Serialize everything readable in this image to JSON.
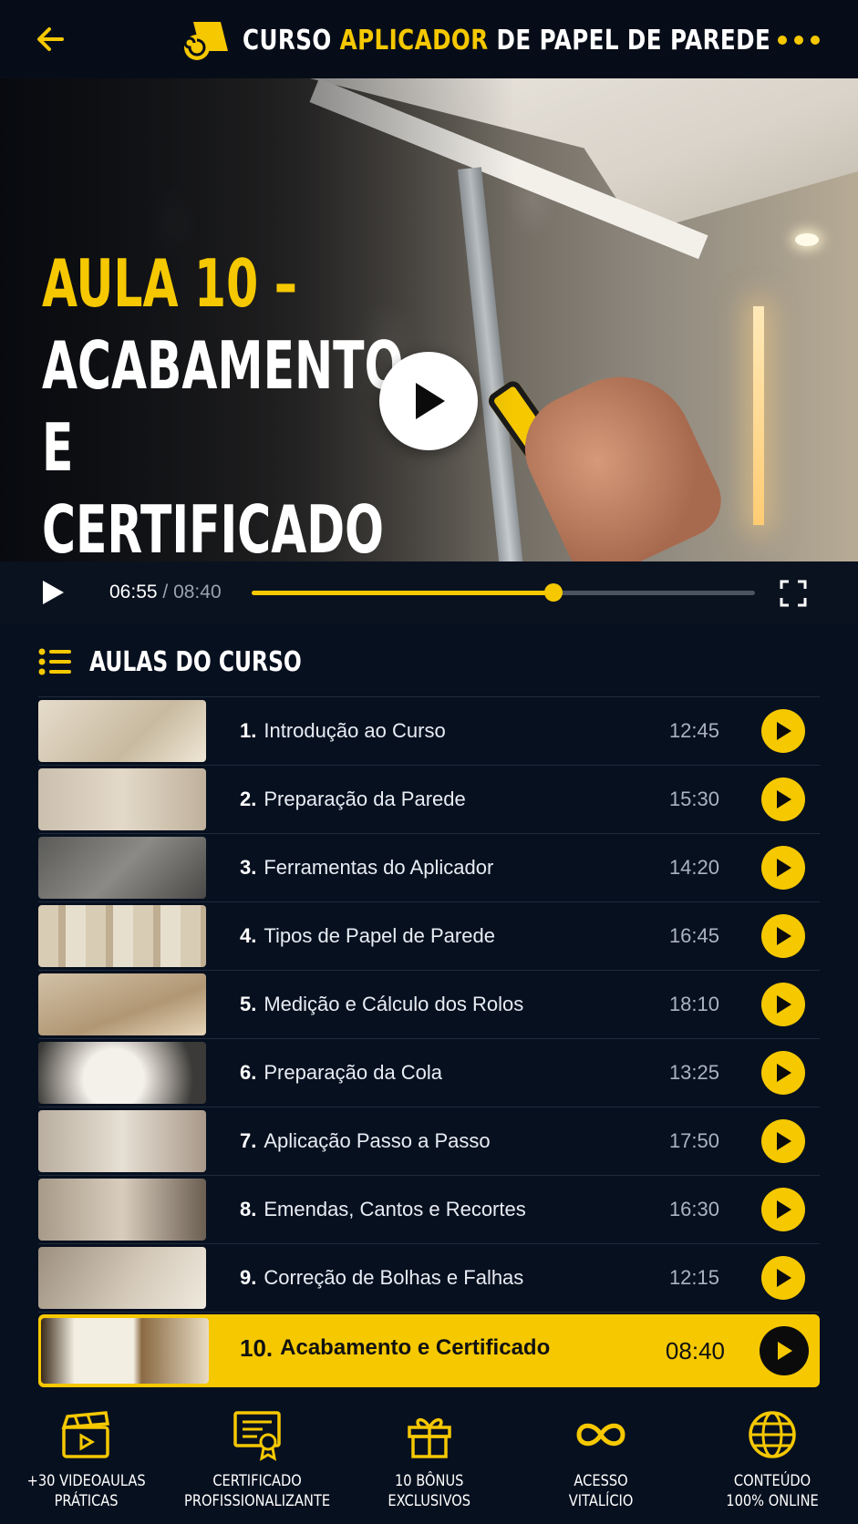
{
  "header": {
    "title_part1": "CURSO ",
    "title_highlight": "APLICADOR",
    "title_part2": " DE PAPEL DE PAREDE",
    "back_icon": "arrow-left-icon",
    "more_icon": "more-dots-icon"
  },
  "video": {
    "lesson_number": "AULA 10 –",
    "lesson_title": "ACABAMENTO E\nCERTIFICADO",
    "current_time": "06:55",
    "separator": " / ",
    "total_time": "08:40",
    "progress_fraction": 0.6
  },
  "lessons_section": {
    "title": "AULAS DO CURSO",
    "items": [
      {
        "num": "1.",
        "title": "Introdução ao Curso",
        "duration": "12:45",
        "thumb": "wallpaper-rolls"
      },
      {
        "num": "2.",
        "title": "Preparação da Parede",
        "duration": "15:30",
        "thumb": "brush-wall"
      },
      {
        "num": "3.",
        "title": "Ferramentas do Aplicador",
        "duration": "14:20",
        "thumb": "tools"
      },
      {
        "num": "4.",
        "title": "Tipos de Papel de Parede",
        "duration": "16:45",
        "thumb": "rolls-row"
      },
      {
        "num": "5.",
        "title": "Medição e Cálculo dos Rolos",
        "duration": "18:10",
        "thumb": "measuring-tape"
      },
      {
        "num": "6.",
        "title": "Preparação da Cola",
        "duration": "13:25",
        "thumb": "glue-bucket"
      },
      {
        "num": "7.",
        "title": "Aplicação Passo a Passo",
        "duration": "17:50",
        "thumb": "applying"
      },
      {
        "num": "8.",
        "title": "Emendas, Cantos e Recortes",
        "duration": "16:30",
        "thumb": "trimming"
      },
      {
        "num": "9.",
        "title": "Correção de Bolhas e Falhas",
        "duration": "12:15",
        "thumb": "smoothing"
      },
      {
        "num": "10.",
        "title": "Acabamento e Certificado",
        "duration": "08:40",
        "thumb": "certificate",
        "active": true
      }
    ]
  },
  "features": [
    {
      "icon": "clapperboard-icon",
      "text": "+30 VIDEOAULAS\nPRÁTICAS"
    },
    {
      "icon": "certificate-icon",
      "text": "CERTIFICADO\nPROFISSIONALIZANTE"
    },
    {
      "icon": "gift-icon",
      "text": "10 BÔNUS\nEXCLUSIVOS"
    },
    {
      "icon": "infinity-icon",
      "text": "ACESSO\nVITALÍCIO"
    },
    {
      "icon": "globe-icon",
      "text": "CONTEÚDO\n100% ONLINE"
    }
  ],
  "colors": {
    "accent": "#f5c800",
    "background": "#07101f"
  }
}
